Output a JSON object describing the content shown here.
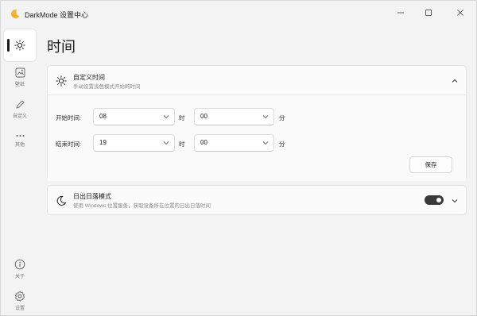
{
  "window": {
    "title": "DarkMode 设置中心"
  },
  "sidebar": {
    "items": [
      {
        "id": "time",
        "label": "",
        "icon": "sun-icon",
        "active": true
      },
      {
        "id": "wallpaper",
        "label": "壁纸",
        "icon": "wallpaper-icon"
      },
      {
        "id": "custom",
        "label": "自定义",
        "icon": "pen-icon"
      },
      {
        "id": "other",
        "label": "其他",
        "icon": "more-icon"
      }
    ],
    "bottom": [
      {
        "id": "about",
        "label": "关于",
        "icon": "info-icon"
      },
      {
        "id": "settings",
        "label": "设置",
        "icon": "gear-icon"
      }
    ]
  },
  "page": {
    "title": "时间"
  },
  "custom_time": {
    "title": "自定义时间",
    "subtitle": "手动设置浅色模式开始的时间",
    "start": {
      "label": "开始时间:",
      "hour": "08",
      "hour_unit": "时",
      "minute": "00",
      "minute_unit": "分"
    },
    "end": {
      "label": "结束时间:",
      "hour": "19",
      "hour_unit": "时",
      "minute": "00",
      "minute_unit": "分"
    },
    "save_label": "保存"
  },
  "sunrise": {
    "title": "日出日落模式",
    "subtitle": "使用 Windows 位置服务，获取设备所在位置的日出日落时间",
    "enabled": true
  },
  "colors": {
    "background": "#f3f3f3",
    "card": "#fbfbfb",
    "toggle_on": "#3a3a3a"
  }
}
